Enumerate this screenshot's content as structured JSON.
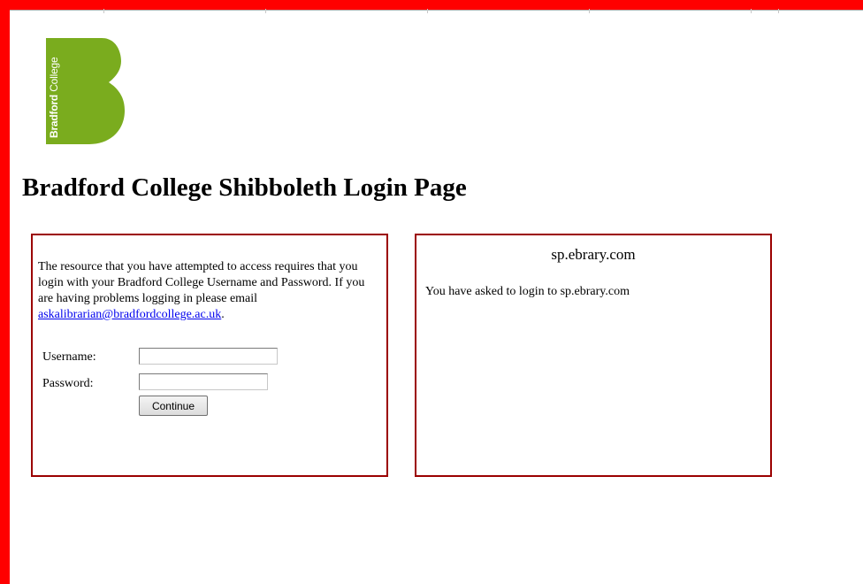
{
  "logo": {
    "text_bold": "Bradford",
    "text_regular": " College",
    "color": "#7aac1e"
  },
  "page": {
    "title": "Bradford College Shibboleth Login Page"
  },
  "login_panel": {
    "intro_text": "The resource that you have attempted to access requires that you login with your Bradford College Username and Password. If you are having problems logging in please email ",
    "email_link": "askalibrarian@bradfordcollege.ac.uk",
    "intro_end": ".",
    "username_label": "Username:",
    "username_value": "",
    "password_label": "Password:",
    "password_value": "",
    "continue_label": "Continue"
  },
  "service_panel": {
    "title": "sp.ebrary.com",
    "message": "You have asked to login to sp.ebrary.com"
  },
  "colors": {
    "frame": "#ff0000",
    "panel_border": "#9b0000",
    "link": "#0000ee"
  }
}
